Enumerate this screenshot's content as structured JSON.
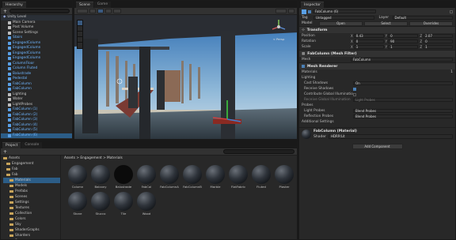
{
  "hierarchy": {
    "tab_label": "Hierarchy",
    "root": "Unity Level",
    "items": [
      {
        "label": "Main Camera",
        "prefab": false
      },
      {
        "label": "Post Volume",
        "prefab": false
      },
      {
        "label": "Scene Settings",
        "prefab": false
      },
      {
        "label": "Stairs",
        "prefab": true
      },
      {
        "label": "EngagedColumn",
        "prefab": true
      },
      {
        "label": "EngagedColumn",
        "prefab": true
      },
      {
        "label": "EngagedColumn",
        "prefab": true
      },
      {
        "label": "EngagedColumn",
        "prefab": true
      },
      {
        "label": "ColumnFloor",
        "prefab": true
      },
      {
        "label": "Column Fluted",
        "prefab": true
      },
      {
        "label": "Balustrade",
        "prefab": true
      },
      {
        "label": "Pedestal",
        "prefab": true
      },
      {
        "label": "FabColumn",
        "prefab": true
      },
      {
        "label": "FabColumn",
        "prefab": true
      },
      {
        "label": "Lighting",
        "prefab": false
      },
      {
        "label": "Water",
        "prefab": false
      },
      {
        "label": "LightProbes",
        "prefab": false
      },
      {
        "label": "FabColumn (1)",
        "prefab": true
      },
      {
        "label": "FabColumn (2)",
        "prefab": true
      },
      {
        "label": "FabColumn (3)",
        "prefab": true
      },
      {
        "label": "FabColumn (4)",
        "prefab": true
      },
      {
        "label": "FabColumn (5)",
        "prefab": true
      },
      {
        "label": "FabColumn (6)",
        "prefab": true
      }
    ]
  },
  "scene": {
    "tabs": [
      "Scene",
      "Game"
    ],
    "persp_label": "< Persp"
  },
  "inspector": {
    "tab_label": "Inspector",
    "object_name": "FabColumn (6)",
    "tag_label": "Tag",
    "tag_value": "Untagged",
    "layer_label": "Layer",
    "layer_value": "Default",
    "model_label": "Model",
    "open_label": "Open",
    "select_label": "Select",
    "overrides_label": "Overrides",
    "transform": {
      "title": "Transform",
      "position": {
        "label": "Position",
        "x": "0.43",
        "y": "0",
        "z": "2.07"
      },
      "rotation": {
        "label": "Rotation",
        "x": "0",
        "y": "90",
        "z": "0"
      },
      "scale": {
        "label": "Scale",
        "x": "1",
        "y": "1",
        "z": "1"
      }
    },
    "mesh_filter": {
      "title": "FabColumn (Mesh Filter)",
      "mesh_label": "Mesh",
      "mesh_value": "FabColumn"
    },
    "mesh_renderer": {
      "title": "Mesh Renderer",
      "materials_label": "Materials",
      "materials_count": "1",
      "lighting_label": "Lighting",
      "cast_shadows_label": "Cast Shadows",
      "cast_shadows_value": "On",
      "receive_label": "Receive Shadows",
      "contribute_label": "Contribute Global Illumination",
      "receive_gi_label": "Receive Global Illumination",
      "receive_gi_value": "Light Probes",
      "probes_label": "Probes",
      "light_probes_label": "Light Probes",
      "light_probes_value": "Blend Probes",
      "reflection_label": "Reflection Probes",
      "reflection_value": "Blend Probes",
      "additional_label": "Additional Settings"
    },
    "material": {
      "title": "FabColumn (Material)",
      "shader_label": "Shader",
      "shader_value": "HDRP/Lit"
    },
    "add_component": "Add Component"
  },
  "project": {
    "tabs": [
      "Project",
      "Console"
    ],
    "breadcrumb": "Assets > Engagement > Materials",
    "tree": [
      "Assets",
      "Engagement",
      "Fab",
      "Fab",
      "Materials",
      "Models",
      "Prefabs",
      "Scenes",
      "Settings",
      "Textures",
      "Collection",
      "Colors",
      "Sky",
      "ShaderGraphs",
      "Sharders",
      "Seasons"
    ],
    "assets": [
      "Column",
      "Balcony",
      "Balustrade",
      "FabCol",
      "FabColumnA",
      "FabColumnB",
      "Marble",
      "FlatFabric",
      "Fluted",
      "Plaster",
      "Stone",
      "Stucco",
      "Tile",
      "Wood"
    ]
  }
}
